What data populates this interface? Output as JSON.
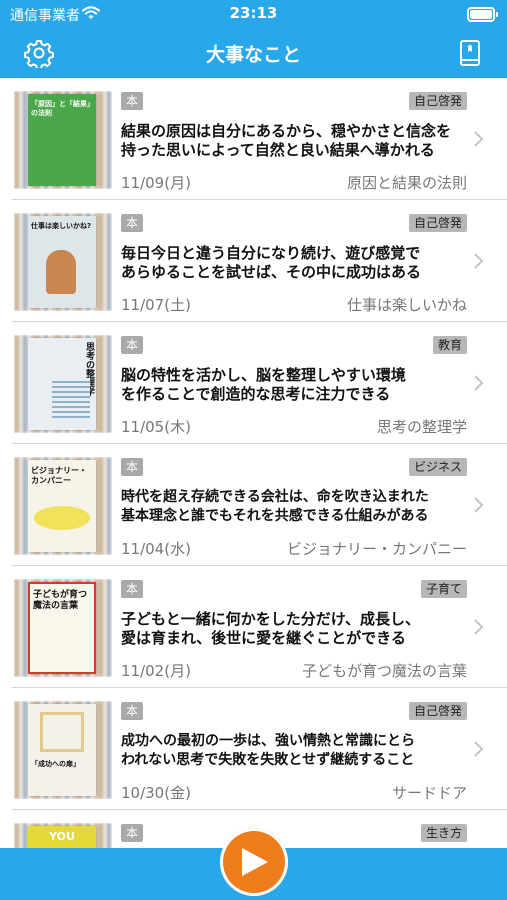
{
  "status_bar": {
    "carrier": "通信事業者",
    "time": "23:13"
  },
  "nav": {
    "title": "大事なこと",
    "left_icon": "gear-icon",
    "right_icon": "book-icon"
  },
  "colors": {
    "accent": "#28a8e8",
    "play": "#f07d1c",
    "badge": "#a9a9a9"
  },
  "rows": [
    {
      "type": "本",
      "category": "自己啓発",
      "line1": "結果の原因は自分にあるから、穏やかさと信念を",
      "line2": "持った思いによって自然と良い結果へ導かれる",
      "date": "11/09(月)",
      "book": "原因と結果の法則",
      "cover_text": "「原因」と「結果」の法則",
      "cover_color": "#4aa84a"
    },
    {
      "type": "本",
      "category": "自己啓発",
      "line1": "毎日今日と違う自分になり続け、遊び感覚で",
      "line2": "あらゆることを試せば、その中に成功はある",
      "date": "11/07(土)",
      "book": "仕事は楽しいかね",
      "cover_text": "仕事は楽しいかね?",
      "cover_color": "#6b7f8c"
    },
    {
      "type": "本",
      "category": "教育",
      "line1": "脳の特性を活かし、脳を整理しやすい環境",
      "line2": "を作ることで創造的な思考に注力できる",
      "date": "11/05(木)",
      "book": "思考の整理学",
      "cover_text": "思考の整理学",
      "cover_color": "#e9eef2"
    },
    {
      "type": "本",
      "category": "ビジネス",
      "line1": "時代を超え存続できる会社は、命を吹き込まれた",
      "line2": "基本理念と誰でもそれを共感できる仕組みがある",
      "date": "11/04(水)",
      "book": "ビジョナリー・カンパニー",
      "cover_text": "ビジョナリー・カンパニー",
      "cover_color": "#f6f3e8"
    },
    {
      "type": "本",
      "category": "子育て",
      "line1": "子どもと一緒に何かをした分だけ、成長し、",
      "line2": "愛は育まれ、後世に愛を継ぐことができる",
      "date": "11/02(月)",
      "book": "子どもが育つ魔法の言葉",
      "cover_text": "子どもが育つ魔法の言葉",
      "cover_color": "#fbf6ec"
    },
    {
      "type": "本",
      "category": "自己啓発",
      "line1": "成功への最初の一歩は、強い情熱と常識にとら",
      "line2": "われない思考で失敗を失敗とせず継続すること",
      "date": "10/30(金)",
      "book": "サードドア",
      "cover_text": "「成功への扉」",
      "cover_color": "#f4f1ea"
    },
    {
      "type": "本",
      "category": "生き方",
      "line1": "",
      "line2": "",
      "date": "",
      "book": "",
      "cover_text": "YOU",
      "cover_color": "#e5d93a"
    }
  ],
  "bottom": {
    "play_icon": "play-icon"
  }
}
